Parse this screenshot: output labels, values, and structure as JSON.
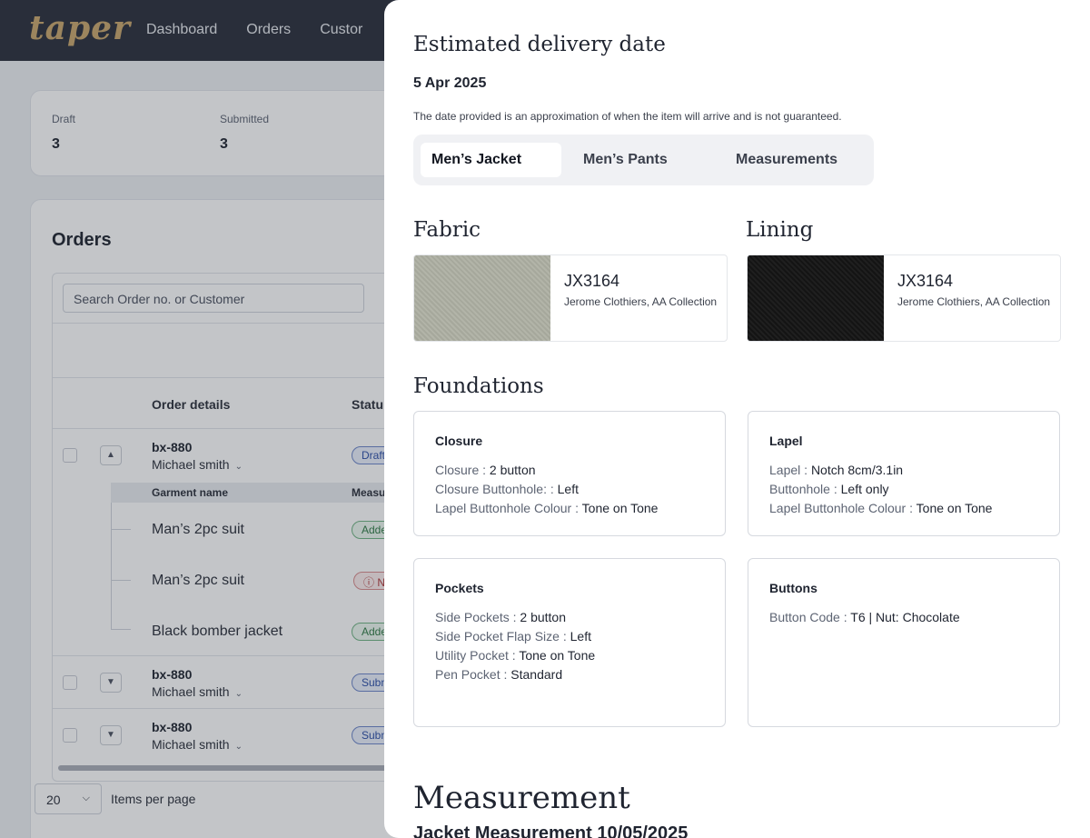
{
  "app": {
    "logo": "taper",
    "nav": [
      "Dashboard",
      "Orders",
      "Custor"
    ]
  },
  "stats": [
    {
      "label": "Draft",
      "value": "3"
    },
    {
      "label": "Submitted",
      "value": "3"
    }
  ],
  "orders": {
    "title": "Orders",
    "search_placeholder": "Search Order no. or Customer",
    "headers": {
      "order_details": "Order details",
      "status": "Statu"
    },
    "sub_headers": {
      "garment_name": "Garment  name",
      "measurement": "Measu"
    },
    "rows": [
      {
        "id": "bx-880",
        "customer": "Michael smith",
        "status": "Draft",
        "expanded": true,
        "garments": [
          {
            "name": "Man’s 2pc suit",
            "status": "Adde",
            "tone": "green"
          },
          {
            "name": "Man’s 2pc suit",
            "status": "N",
            "tone": "red"
          },
          {
            "name": "Black bomber jacket",
            "status": "Adde",
            "tone": "green"
          }
        ]
      },
      {
        "id": "bx-880",
        "customer": "Michael smith",
        "status": "Subn",
        "expanded": false
      },
      {
        "id": "bx-880",
        "customer": "Michael smith",
        "status": "Subn",
        "expanded": false
      }
    ],
    "per_page": "20",
    "per_page_label": "Items per page"
  },
  "drawer": {
    "delivery_title": "Estimated delivery date",
    "delivery_date": "5 Apr 2025",
    "delivery_note": "The date provided is an approximation of when the item will arrive and is not guaranteed.",
    "tabs": [
      {
        "label": "Men’s Jacket",
        "active": true
      },
      {
        "label": "Men’s Pants",
        "active": false
      },
      {
        "label": "Measurements",
        "active": false
      }
    ],
    "fabric": {
      "heading": "Fabric",
      "code": "JX3164",
      "collection": "Jerome Clothiers, AA Collection",
      "swatch_color": "#a9ab9f"
    },
    "lining": {
      "heading": "Lining",
      "code": "JX3164",
      "collection": "Jerome Clothiers, AA Collection",
      "swatch_color": "#181818"
    },
    "foundations_heading": "Foundations",
    "cards": [
      {
        "title": "Closure",
        "rows": [
          {
            "k": "Closure",
            "v": "2 button"
          },
          {
            "k": "Closure Buttonhole: ",
            "v": "Left"
          },
          {
            "k": "Lapel Buttonhole Colour",
            "v": "Tone on Tone"
          }
        ]
      },
      {
        "title": "Lapel",
        "rows": [
          {
            "k": "Lapel",
            "v": "Notch 8cm/3.1in"
          },
          {
            "k": "Buttonhole",
            "v": "Left only"
          },
          {
            "k": "Lapel Buttonhole Colour",
            "v": "Tone on Tone"
          }
        ]
      },
      {
        "title": "Pockets",
        "rows": [
          {
            "k": "Side Pockets",
            "v": "2 button"
          },
          {
            "k": "Side Pocket Flap Size",
            "v": "Left"
          },
          {
            "k": "Utility Pocket",
            "v": "Tone on Tone"
          },
          {
            "k": "Pen Pocket",
            "v": "Standard"
          }
        ]
      },
      {
        "title": "Buttons",
        "rows": [
          {
            "k": "Button Code",
            "v": "T6 | Nut: Chocolate"
          }
        ]
      }
    ],
    "measurement_heading": "Measurement",
    "measurement_sub": "Jacket Measurement 10/05/2025"
  }
}
